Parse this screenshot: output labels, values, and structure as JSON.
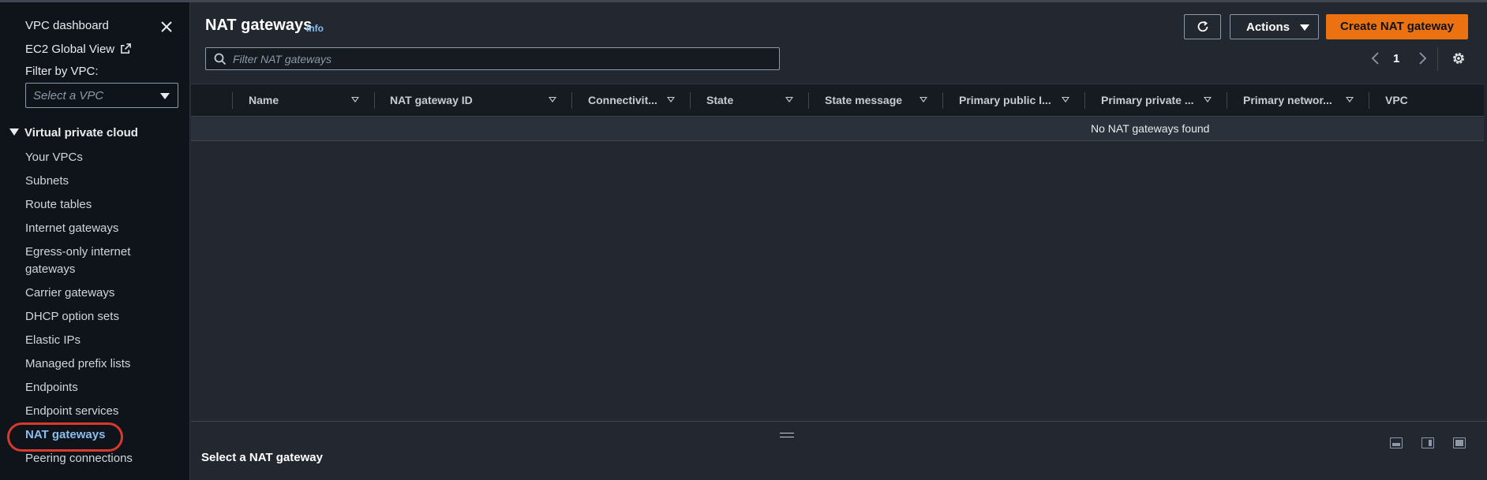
{
  "sidebar": {
    "vpc_dashboard": "VPC dashboard",
    "ec2_global_view": "EC2 Global View",
    "filter_label": "Filter by VPC:",
    "select_placeholder": "Select a VPC",
    "section_title": "Virtual private cloud",
    "items": [
      {
        "label": "Your VPCs"
      },
      {
        "label": "Subnets"
      },
      {
        "label": "Route tables"
      },
      {
        "label": "Internet gateways"
      },
      {
        "label": "Egress-only internet gateways"
      },
      {
        "label": "Carrier gateways"
      },
      {
        "label": "DHCP option sets"
      },
      {
        "label": "Elastic IPs"
      },
      {
        "label": "Managed prefix lists"
      },
      {
        "label": "Endpoints"
      },
      {
        "label": "Endpoint services"
      },
      {
        "label": "NAT gateways",
        "active": true
      },
      {
        "label": "Peering connections"
      }
    ]
  },
  "header": {
    "title": "NAT gateways",
    "info": "Info",
    "actions_label": "Actions",
    "create_label": "Create NAT gateway"
  },
  "search": {
    "placeholder": "Filter NAT gateways"
  },
  "pagination": {
    "current_page": "1"
  },
  "table": {
    "columns": [
      "Name",
      "NAT gateway ID",
      "Connectivit...",
      "State",
      "State message",
      "Primary public I...",
      "Primary private ...",
      "Primary networ...",
      "VPC"
    ],
    "empty_message": "No NAT gateways found"
  },
  "split_panel": {
    "title": "Select a NAT gateway"
  },
  "colors": {
    "accent_orange": "#ec7211",
    "link_blue": "#89bdee",
    "highlight_red": "#d8392b"
  }
}
